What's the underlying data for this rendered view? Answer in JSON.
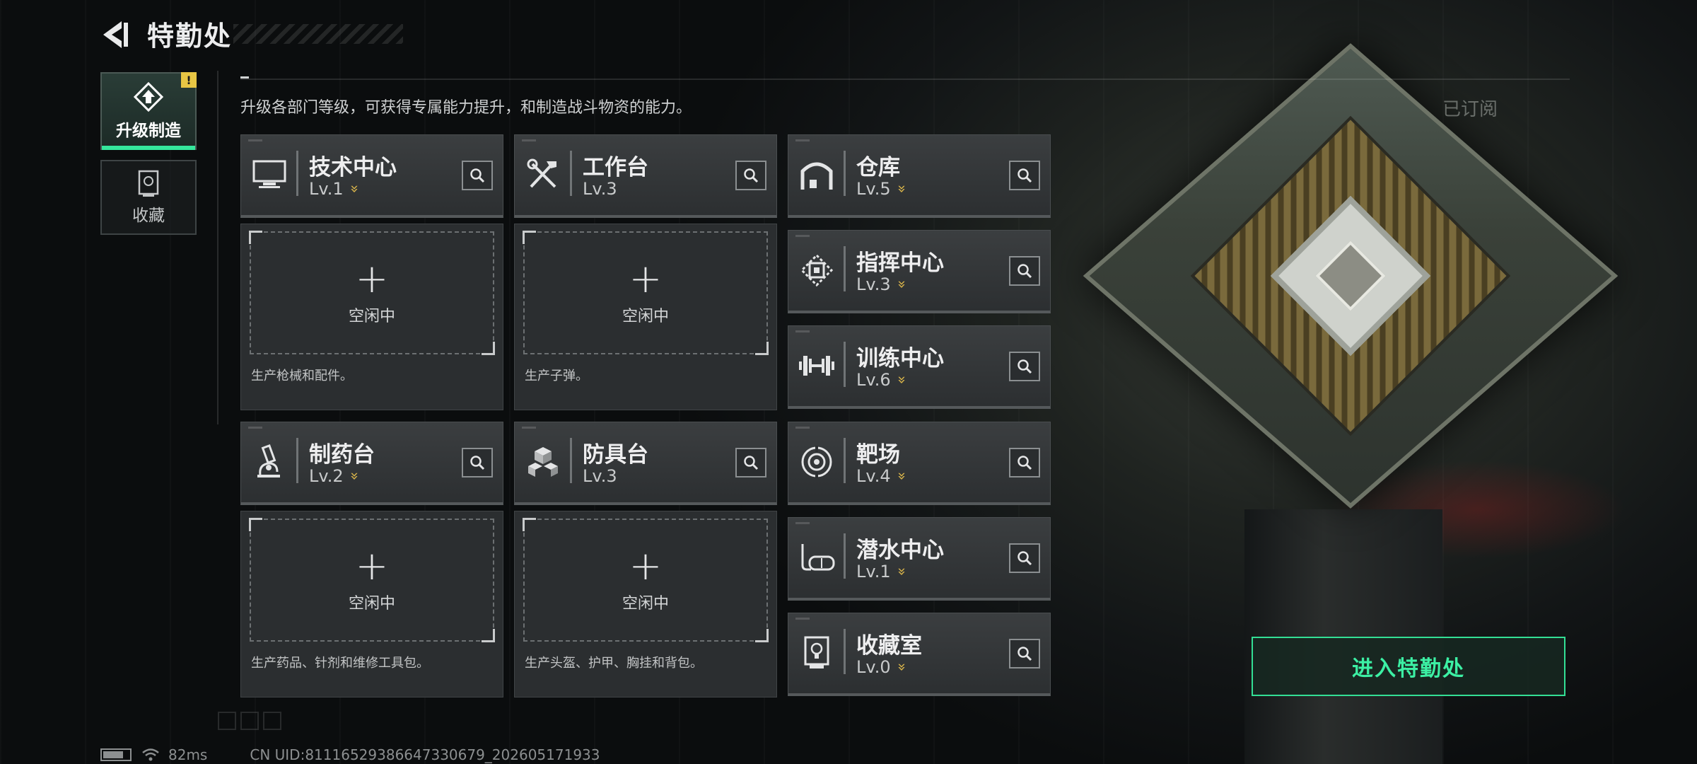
{
  "header": {
    "title": "特勤处"
  },
  "description": "升级各部门等级，可获得专属能力提升，和制造战斗物资的能力。",
  "tabs": [
    {
      "label": "升级制造",
      "active": true,
      "icon": "upgrade-icon",
      "badge": "!"
    },
    {
      "label": "收藏",
      "active": false,
      "icon": "collection-icon"
    }
  ],
  "departments": [
    {
      "name": "技术中心",
      "level": "Lv.1",
      "upgradable": true,
      "icon": "monitor-icon"
    },
    {
      "name": "工作台",
      "level": "Lv.3",
      "upgradable": false,
      "icon": "tools-icon"
    },
    {
      "name": "仓库",
      "level": "Lv.5",
      "upgradable": true,
      "icon": "warehouse-icon"
    },
    {
      "name": "指挥中心",
      "level": "Lv.3",
      "upgradable": true,
      "icon": "chip-icon"
    },
    {
      "name": "训练中心",
      "level": "Lv.6",
      "upgradable": true,
      "icon": "dumbbell-icon"
    },
    {
      "name": "制药台",
      "level": "Lv.2",
      "upgradable": true,
      "icon": "microscope-icon"
    },
    {
      "name": "防具台",
      "level": "Lv.3",
      "upgradable": false,
      "icon": "armor-blocks-icon"
    },
    {
      "name": "靶场",
      "level": "Lv.4",
      "upgradable": true,
      "icon": "target-icon"
    },
    {
      "name": "潜水中心",
      "level": "Lv.1",
      "upgradable": true,
      "icon": "diving-mask-icon"
    },
    {
      "name": "收藏室",
      "level": "Lv.0",
      "upgradable": true,
      "icon": "trophy-icon"
    }
  ],
  "slots": [
    {
      "plus": "+",
      "status": "空闲中",
      "desc": "生产枪械和配件。"
    },
    {
      "plus": "+",
      "status": "空闲中",
      "desc": "生产子弹。"
    },
    {
      "plus": "+",
      "status": "空闲中",
      "desc": "生产药品、针剂和维修工具包。"
    },
    {
      "plus": "+",
      "status": "空闲中",
      "desc": "生产头盔、护甲、胸挂和背包。"
    }
  ],
  "right": {
    "subscribed": "已订阅",
    "enter_button": "进入特勤处"
  },
  "footer": {
    "ping": "82ms",
    "uid": "CN UID:8111652938664733067​9_202605171933"
  },
  "colors": {
    "accent": "#35e79c",
    "upgrade": "#d9b44a",
    "warning": "#e8c644"
  }
}
